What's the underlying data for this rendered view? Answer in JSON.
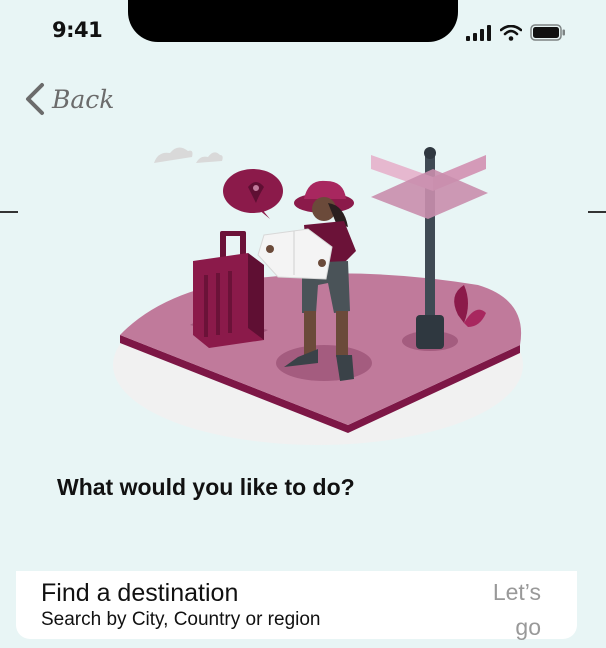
{
  "status_bar": {
    "time": "9:41",
    "icons": [
      "signal-icon",
      "wifi-icon",
      "battery-icon"
    ]
  },
  "header": {
    "back_label": "Back",
    "back_icon": "chevron-left-icon"
  },
  "main": {
    "question": "What would you like to do?"
  },
  "destination_card": {
    "title": "Find a destination",
    "subtitle": "Search by City, Country or region",
    "cta": "Let’s go"
  },
  "colors": {
    "background": "#e8f5f5",
    "accent": "#8b1a4a",
    "accent_light": "#c28aa6",
    "card": "#ffffff",
    "muted_text": "#999999"
  }
}
